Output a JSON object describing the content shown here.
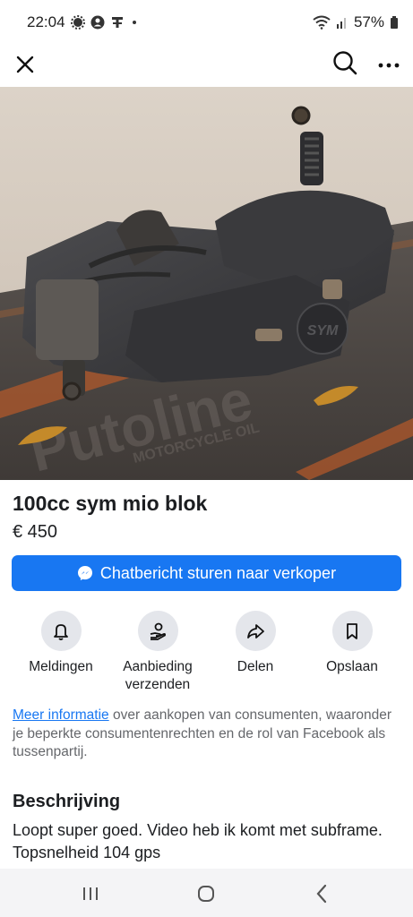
{
  "status_bar": {
    "time": "22:04",
    "battery": "57%"
  },
  "listing": {
    "title": "100cc sym mio blok",
    "price": "€ 450",
    "photo_text": {
      "brand": "Putoline",
      "sub": "MOTORCYCLE OIL",
      "emblem": "SYM"
    }
  },
  "cta": {
    "label": "Chatbericht sturen naar verkoper"
  },
  "actions": [
    {
      "label": "Meldingen",
      "icon": "bell-icon"
    },
    {
      "label": "Aanbieding verzenden",
      "icon": "offer-icon"
    },
    {
      "label": "Delen",
      "icon": "share-icon"
    },
    {
      "label": "Opslaan",
      "icon": "bookmark-icon"
    }
  ],
  "info": {
    "link_text": "Meer informatie",
    "text": " over aankopen van consumenten, waaronder je beperkte consumentenrechten en de rol van Facebook als tussenpartij."
  },
  "description": {
    "heading": "Beschrijving",
    "text": "Loopt super goed. Video heb ik komt met subframe.\nTopsnelheid 104 gps"
  },
  "colors": {
    "accent": "#1877f2",
    "action_bg": "#e4e6eb",
    "muted_text": "#65676b"
  }
}
